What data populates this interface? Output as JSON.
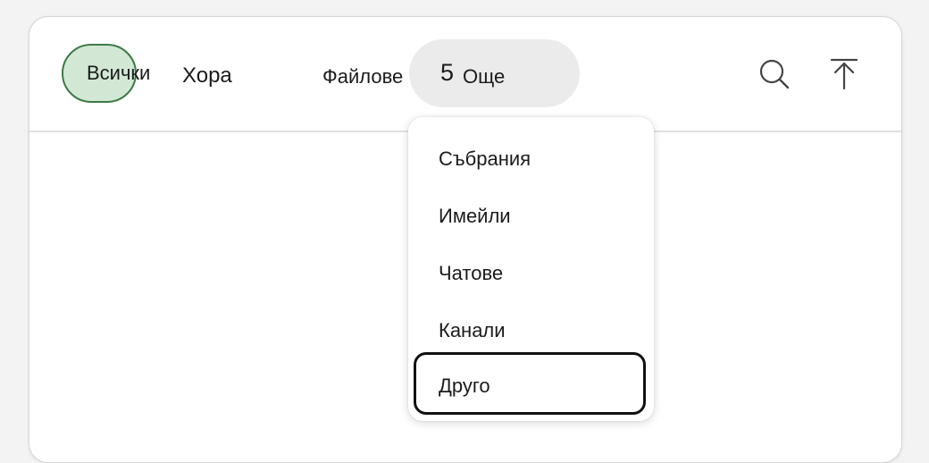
{
  "tabs": {
    "all": "Всички",
    "people": "Хора",
    "files": "Файлове",
    "more_count": "5",
    "more": "Още"
  },
  "toolbar": {
    "search_icon": "search-icon",
    "scroll_top_icon": "arrow-up-to-line-icon"
  },
  "dropdown": {
    "items": [
      "Събрания",
      "Имейли",
      "Чатове",
      "Канали",
      "Друго"
    ],
    "selected": "Друго"
  },
  "colors": {
    "active_tab_fill": "#d2e8d5",
    "active_tab_border": "#3d7a46",
    "more_pill": "#ebebeb",
    "focus_border": "#111111"
  }
}
